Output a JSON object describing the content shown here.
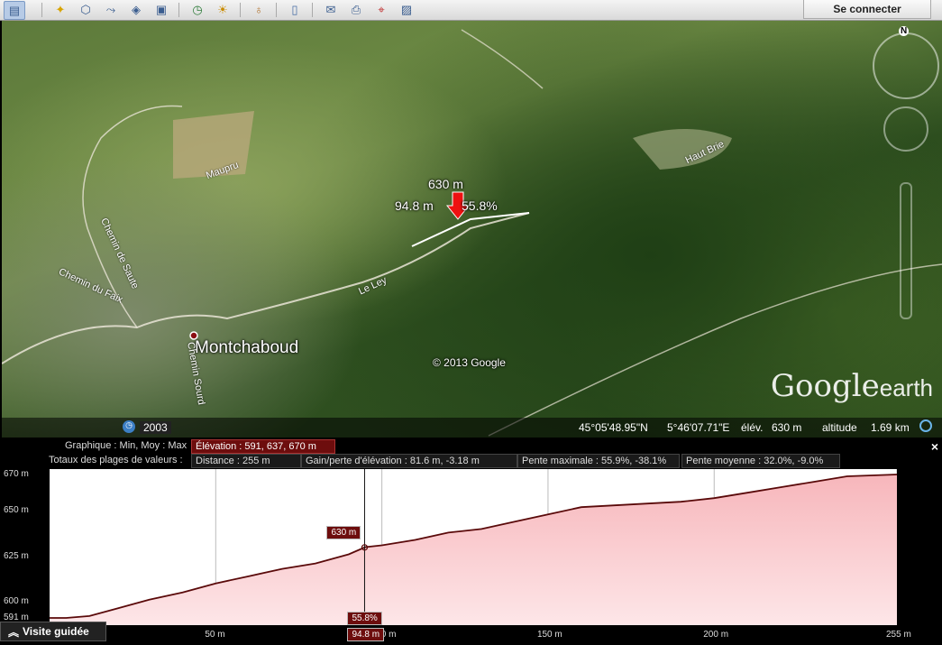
{
  "toolbar": {
    "signin_label": "Se connecter",
    "tools": [
      "sidebar-icon",
      "placemark-icon",
      "polygon-icon",
      "path-icon",
      "overlay-icon",
      "tour-icon",
      "history-icon",
      "sun-icon",
      "planet-icon",
      "ruler-icon",
      "email-icon",
      "print-icon",
      "maps-icon",
      "save-image-icon"
    ]
  },
  "map": {
    "place_label": "Montchaboud",
    "roads": [
      "Chemin de Saute",
      "Chemin du Faix",
      "Chemin Sourd",
      "Le Ley",
      "Haut Brie",
      "Maupru"
    ],
    "copyright": "© 2013 Google",
    "logo": "Google",
    "logo_suffix": "earth",
    "compass_n": "N",
    "marker": {
      "elevation": "630 m",
      "distance": "94.8 m",
      "slope": "55.8%"
    },
    "status": {
      "imagery_year": "2003",
      "lat": "45°05'48.95\"N",
      "lon": "5°46'07.71\"E",
      "elev_label": "élév.",
      "elev": "630 m",
      "alt_label": "altitude",
      "alt": "1.69 km"
    }
  },
  "panel": {
    "graph_label": "Graphique : Min, Moy : Max",
    "elevation_badge": "Élévation : 591, 637, 670 m",
    "totals_label": "Totaux des plages de valeurs :",
    "distance": "Distance : 255 m",
    "gain": "Gain/perte d'élévation : 81.6 m, -3.18 m",
    "max_slope": "Pente maximale : 55.9%, -38.1%",
    "avg_slope": "Pente moyenne : 32.0%, -9.0%",
    "close": "×",
    "tour_label": "Visite guidée"
  },
  "chart_data": {
    "type": "area",
    "title": "",
    "xlabel": "",
    "ylabel": "",
    "x_unit": "m",
    "y_unit": "m",
    "xlim": [
      0,
      255
    ],
    "ylim": [
      587,
      673
    ],
    "y_ticks": [
      "670 m",
      "650 m",
      "625 m",
      "600 m",
      "591 m"
    ],
    "y_tick_values": [
      670,
      650,
      625,
      600,
      591
    ],
    "x_ticks": [
      "50 m",
      "100 m",
      "150 m",
      "200 m",
      "255 m"
    ],
    "x_tick_values": [
      50,
      100,
      150,
      200,
      255
    ],
    "series": [
      {
        "x": [
          0,
          5,
          12,
          20,
          30,
          40,
          50,
          60,
          70,
          80,
          90,
          95,
          100,
          110,
          120,
          130,
          140,
          150,
          160,
          170,
          180,
          190,
          200,
          210,
          220,
          230,
          240,
          255
        ],
        "y": [
          591,
          591,
          592,
          596,
          601,
          605,
          610,
          614,
          618,
          621,
          626,
          630,
          631,
          634,
          638,
          640,
          644,
          648,
          652,
          653,
          654,
          655,
          657,
          660,
          663,
          666,
          669,
          670
        ]
      }
    ],
    "cursor": {
      "x": 94.8,
      "elevation_label": "630 m",
      "slope_label": "55.8%",
      "distance_label": "94.8 m"
    },
    "colors": {
      "line": "#5a0a0a",
      "fill": "#f9c8cc",
      "grid": "#bbbbbb"
    }
  }
}
